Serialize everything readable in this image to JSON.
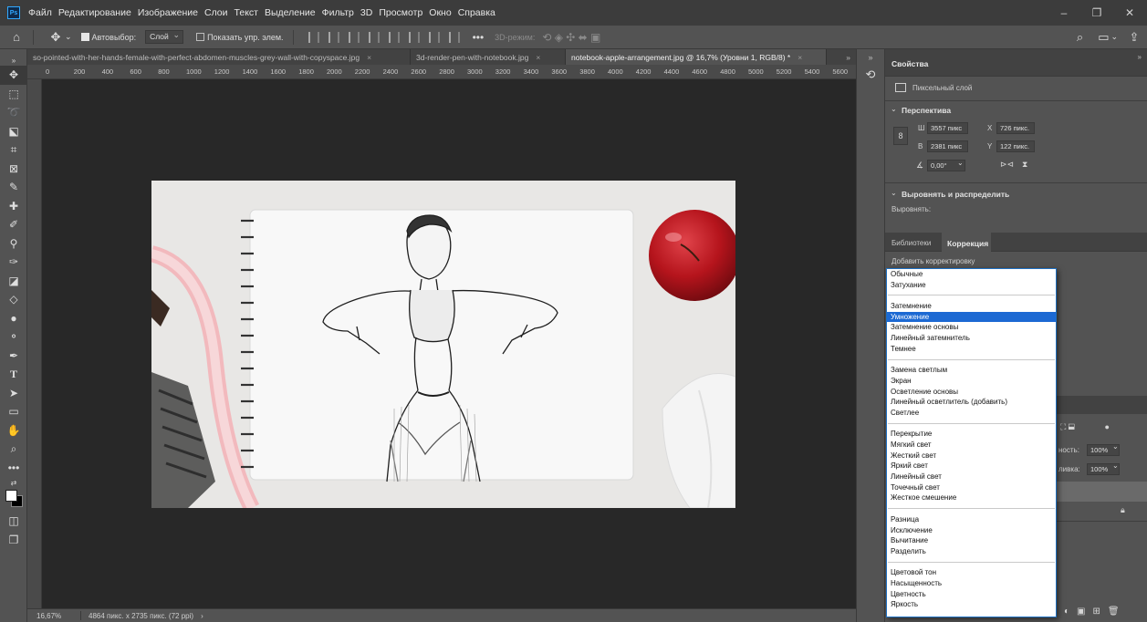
{
  "app": {
    "logo": "Ps"
  },
  "menu": [
    "Файл",
    "Редактирование",
    "Изображение",
    "Слои",
    "Текст",
    "Выделение",
    "Фильтр",
    "3D",
    "Просмотр",
    "Окно",
    "Справка"
  ],
  "options_bar": {
    "auto_select_label": "Автовыбор:",
    "auto_select_value": "Слой",
    "show_transform_label": "Показать упр. элем.",
    "mode_3d_label": "3D-режим:"
  },
  "tabs": [
    {
      "label": "so-pointed-with-her-hands-female-with-perfect-abdomen-muscles-grey-wall-with-copyspace.jpg",
      "close": "×"
    },
    {
      "label": "3d-render-pen-with-notebook.jpg",
      "close": "×"
    },
    {
      "label": "notebook-apple-arrangement.jpg @ 16,7% (Уровни 1, RGB/8) *",
      "close": "×"
    }
  ],
  "tabs_overflow": "»",
  "ruler_top": [
    "0",
    "200",
    "400",
    "600",
    "800",
    "1000",
    "1200",
    "1400",
    "1600",
    "1800",
    "2000",
    "2200",
    "2400",
    "2600",
    "2800",
    "3000",
    "3200",
    "3400",
    "3600",
    "3800",
    "4000",
    "4200",
    "4400",
    "4600",
    "4800",
    "5000",
    "5200",
    "5400",
    "5600"
  ],
  "status": {
    "zoom": "16,67%",
    "doc_info": "4864 пикс. x 2735 пикс. (72 ppi)"
  },
  "properties": {
    "tab": "Свойства",
    "layer_type": "Пиксельный слой",
    "perspective_section": "Перспектива",
    "w_label": "Ш",
    "w_value": "3557 пикс",
    "h_label": "В",
    "h_value": "2381 пикс",
    "x_label": "X",
    "x_value": "726 пикс.",
    "y_label": "Y",
    "y_value": "122 пикс.",
    "angle_value": "0,00°",
    "align_section": "Выровнять и распределить",
    "align_label": "Выровнять:"
  },
  "lower_panel": {
    "tabs": [
      "Библиотеки",
      "Коррекция"
    ],
    "add_adjustment": "Добавить корректировку",
    "opacity_label": "ность:",
    "opacity_value": "100%",
    "fill_label": "ливка:",
    "fill_value": "100%"
  },
  "blend_modes": [
    [
      "Обычные",
      "Затухание"
    ],
    [
      "Затемнение",
      "Умножение",
      "Затемнение основы",
      "Линейный затемнитель",
      "Темнее"
    ],
    [
      "Замена светлым",
      "Экран",
      "Осветление основы",
      "Линейный осветлитель (добавить)",
      "Светлее"
    ],
    [
      "Перекрытие",
      "Мягкий свет",
      "Жесткий свет",
      "Яркий свет",
      "Линейный свет",
      "Точечный свет",
      "Жесткое смешение"
    ],
    [
      "Разница",
      "Исключение",
      "Вычитание",
      "Разделить"
    ],
    [
      "Цветовой тон",
      "Насыщенность",
      "Цветность",
      "Яркость"
    ]
  ],
  "selected_blend_mode": "Умножение",
  "colors": {
    "accent": "#1c69d3",
    "canvas_bg": "#282828",
    "panel_bg": "#535353",
    "apple_red": "#b5141c"
  }
}
